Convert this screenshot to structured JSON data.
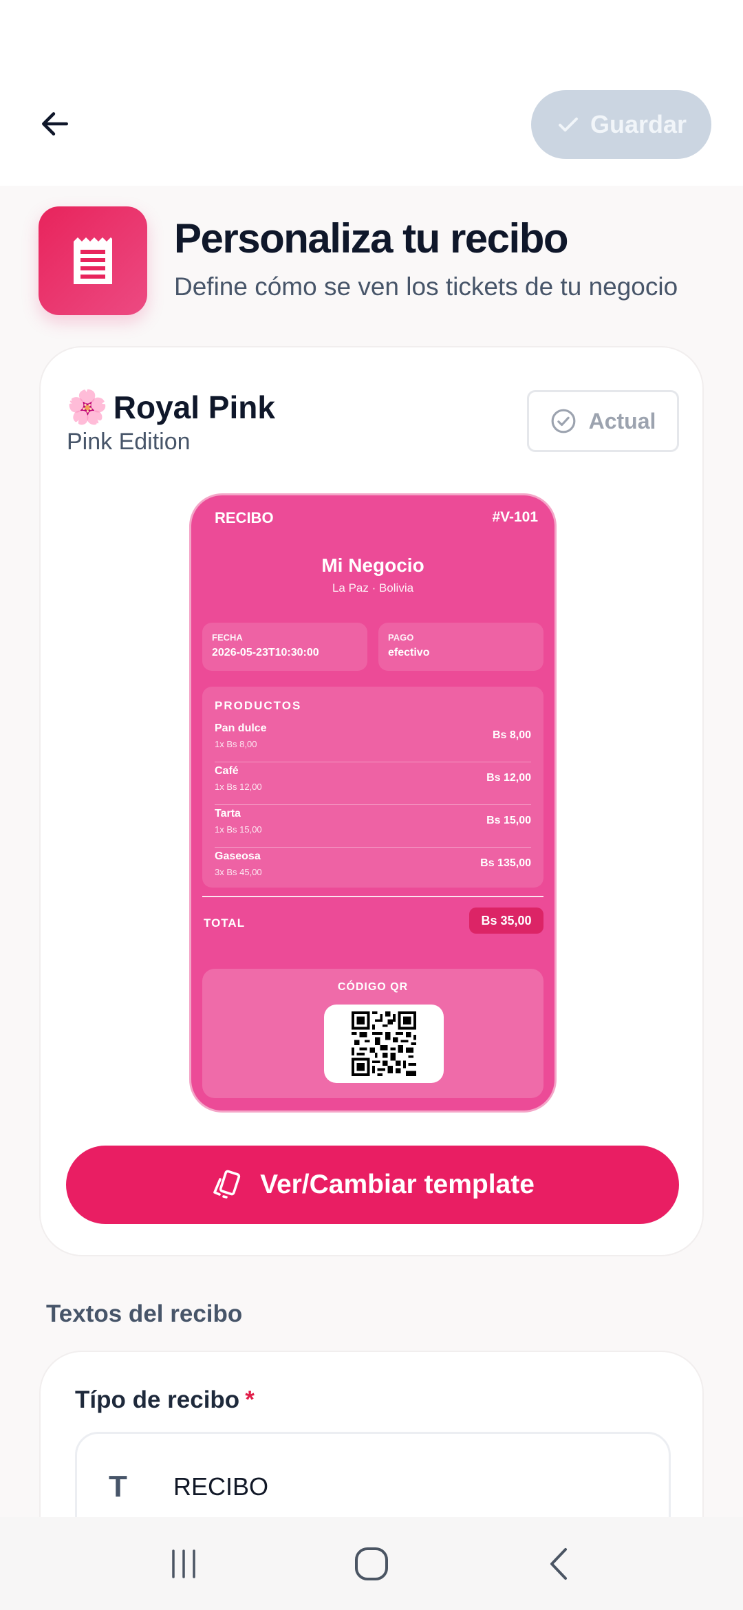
{
  "header": {
    "save_label": "Guardar",
    "title": "Personaliza tu recibo",
    "subtitle": "Define cómo se ven los tickets de tu negocio"
  },
  "template": {
    "emoji": "🌸",
    "name": "Royal Pink",
    "edition": "Pink Edition",
    "current_badge": "Actual",
    "change_button": "Ver/Cambiar template"
  },
  "receipt_preview": {
    "label": "RECIBO",
    "number": "#V-101",
    "business": "Mi Negocio",
    "location": "La Paz · Bolivia",
    "date_label": "FECHA",
    "date_value": "2026-05-23T10:30:00",
    "payment_label": "PAGO",
    "payment_value": "efectivo",
    "products_title": "PRODUCTOS",
    "items": [
      {
        "name": "Pan dulce",
        "detail": "1x Bs 8,00",
        "price": "Bs 8,00"
      },
      {
        "name": "Café",
        "detail": "1x Bs 12,00",
        "price": "Bs 12,00"
      },
      {
        "name": "Tarta",
        "detail": "1x Bs 15,00",
        "price": "Bs 15,00"
      },
      {
        "name": "Gaseosa",
        "detail": "3x Bs 45,00",
        "price": "Bs 135,00"
      }
    ],
    "total_label": "TOTAL",
    "total_value": "Bs 35,00",
    "qr_title": "CÓDIGO QR"
  },
  "texts_section": {
    "title": "Textos del recibo",
    "receipt_type_label": "Típo de recibo",
    "required_mark": "*",
    "receipt_type_value": "RECIBO",
    "field_icon_glyph": "T"
  },
  "colors": {
    "accent": "#e91e63",
    "receipt_bg": "#ec4b97",
    "save_disabled": "#cbd5e1"
  }
}
